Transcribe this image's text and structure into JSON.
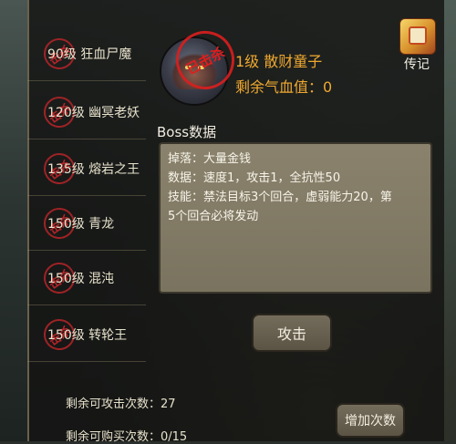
{
  "sidebar": {
    "items": [
      {
        "label": "90级 狂血尸魔",
        "stamp": "击杀"
      },
      {
        "label": "120级 幽冥老妖",
        "stamp": "击杀"
      },
      {
        "label": "135级 熔岩之王",
        "stamp": "击杀"
      },
      {
        "label": "150级 青龙",
        "stamp": "击杀"
      },
      {
        "label": "150级 混沌",
        "stamp": "击杀"
      },
      {
        "label": "150级 转轮王",
        "stamp": "击杀"
      }
    ]
  },
  "boss": {
    "seal_text": "已击杀",
    "name": "1级 散财童子",
    "hp": "剩余气血值：0"
  },
  "chuanji": {
    "label": "传记"
  },
  "details": {
    "title": "Boss数据",
    "lines": [
      "掉落：大量金钱",
      "数据：速度1，攻击1，全抗性50",
      "技能：禁法目标3个回合，虚弱能力20，第",
      "5个回合必将发动"
    ]
  },
  "actions": {
    "attack_label": "攻击",
    "add_label": "增加次数"
  },
  "stats": {
    "attack_remaining": "剩余可攻击次数：27",
    "buy_remaining": "剩余可购买次数：0/15"
  },
  "colors": {
    "accent": "#f0a830",
    "stamp_red": "#c8262a"
  }
}
